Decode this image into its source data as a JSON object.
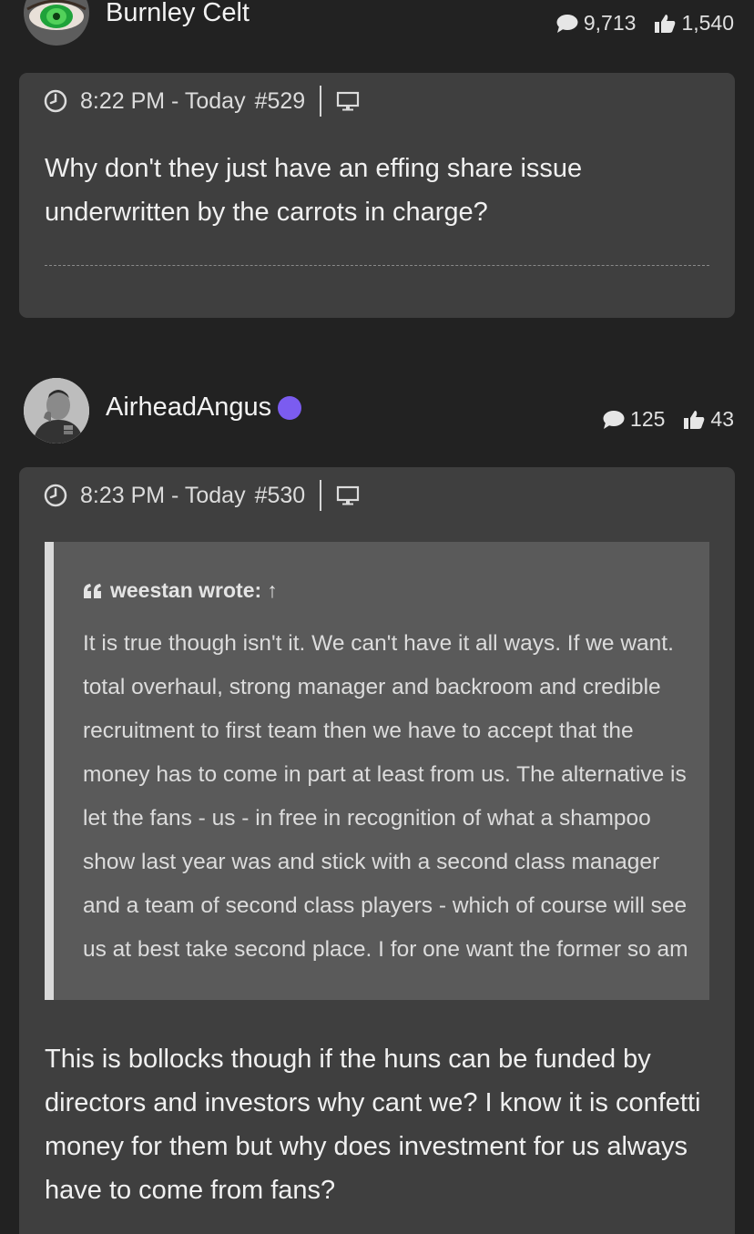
{
  "posts": [
    {
      "username": "Burnley Celt",
      "online": false,
      "comment_count": "9,713",
      "like_count": "1,540",
      "time": "8:22 PM - Today",
      "post_number": "#529",
      "body": "Why don't they just have an effing share issue underwritten by the carrots in charge?"
    },
    {
      "username": "AirheadAngus",
      "online": true,
      "comment_count": "125",
      "like_count": "43",
      "time": "8:23 PM - Today",
      "post_number": "#530",
      "quote": {
        "author_label": "weestan wrote:",
        "arrow": "↑",
        "text": "It is true though isn't it. We can't have it all ways. If we want. total overhaul, strong manager and backroom and credible recruitment to first team then we have to accept that the money has to come in part at least from us. The alternative is let the fans - us - in free in recognition of what a shampoo show last year was and stick with a second class manager and a team of second class players - which of course will see us at best take second place. I for one want the former so am"
      },
      "body": "This is bollocks though if the huns can be funded by directors and investors why cant we? I know it is confetti money for them but why does investment for us always have to come from fans?"
    }
  ],
  "colors": {
    "background": "#222222",
    "card": "#3f3f3f",
    "quote_bg": "#5a5a5a",
    "quote_bar": "#d9d9d9",
    "online_dot": "#7b5cf0"
  },
  "icons": {
    "comments": "speech-bubble-icon",
    "likes": "thumbs-up-icon",
    "time": "clock-icon",
    "device": "desktop-icon",
    "quote": "quote-icon"
  }
}
